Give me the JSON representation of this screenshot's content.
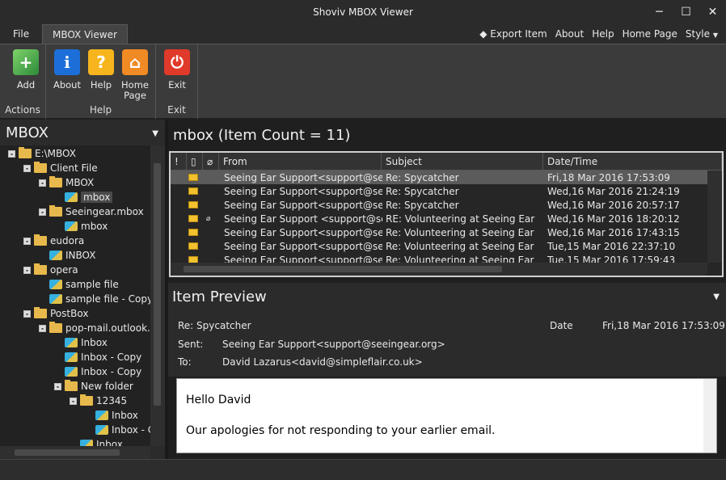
{
  "window": {
    "title": "Shoviv MBOX Viewer",
    "minimize": "─",
    "maximize": "☐",
    "close": "✕"
  },
  "menu": {
    "file": "File",
    "mbox_viewer": "MBOX Viewer",
    "export_item": "Export Item",
    "about": "About",
    "help": "Help",
    "home_page": "Home Page",
    "style": "Style"
  },
  "ribbon": {
    "add": "Add",
    "about": "About",
    "help": "Help",
    "home_page_1": "Home",
    "home_page_2": "Page",
    "exit": "Exit",
    "group_actions": "Actions",
    "group_help": "Help",
    "group_exit": "Exit"
  },
  "left": {
    "title": "MBOX",
    "tree": [
      {
        "label": "E:\\MBOX",
        "depth": 0,
        "type": "folder",
        "exp": "-"
      },
      {
        "label": "Client File",
        "depth": 1,
        "type": "folder",
        "exp": "-"
      },
      {
        "label": "MBOX",
        "depth": 2,
        "type": "folder",
        "exp": "-"
      },
      {
        "label": "mbox",
        "depth": 3,
        "type": "mbox",
        "exp": "",
        "selected": true
      },
      {
        "label": "Seeingear.mbox",
        "depth": 2,
        "type": "folder",
        "exp": "-"
      },
      {
        "label": "mbox",
        "depth": 3,
        "type": "mbox",
        "exp": ""
      },
      {
        "label": "eudora",
        "depth": 1,
        "type": "folder",
        "exp": "-"
      },
      {
        "label": "INBOX",
        "depth": 2,
        "type": "mbox",
        "exp": ""
      },
      {
        "label": "opera",
        "depth": 1,
        "type": "folder",
        "exp": "-"
      },
      {
        "label": "sample file",
        "depth": 2,
        "type": "mbox",
        "exp": ""
      },
      {
        "label": "sample file - Copy",
        "depth": 2,
        "type": "mbox",
        "exp": ""
      },
      {
        "label": "PostBox",
        "depth": 1,
        "type": "folder",
        "exp": "-"
      },
      {
        "label": "pop-mail.outlook.co",
        "depth": 2,
        "type": "folder",
        "exp": "-"
      },
      {
        "label": "Inbox",
        "depth": 3,
        "type": "mbox",
        "exp": ""
      },
      {
        "label": "Inbox - Copy",
        "depth": 3,
        "type": "mbox",
        "exp": ""
      },
      {
        "label": "Inbox - Copy",
        "depth": 3,
        "type": "mbox",
        "exp": ""
      },
      {
        "label": "New folder",
        "depth": 3,
        "type": "folder",
        "exp": "-"
      },
      {
        "label": "12345",
        "depth": 4,
        "type": "folder",
        "exp": "-"
      },
      {
        "label": "Inbox",
        "depth": 5,
        "type": "mbox",
        "exp": ""
      },
      {
        "label": "Inbox - C",
        "depth": 5,
        "type": "mbox",
        "exp": ""
      },
      {
        "label": "Inbox",
        "depth": 4,
        "type": "mbox",
        "exp": ""
      }
    ]
  },
  "list": {
    "title": "mbox (Item Count = 11)",
    "columns": {
      "from": "From",
      "subject": "Subject",
      "date": "Date/Time"
    },
    "rows": [
      {
        "from": "Seeing Ear Support<support@seeinge...",
        "subject": "Re: Spycatcher",
        "date": "Fri,18 Mar 2016 17:53:09",
        "attach": false
      },
      {
        "from": "Seeing Ear Support<support@seeinge...",
        "subject": "Re: Spycatcher",
        "date": "Wed,16 Mar 2016 21:24:19",
        "attach": false
      },
      {
        "from": "Seeing Ear Support<support@seeinge...",
        "subject": "Re: Spycatcher",
        "date": "Wed,16 Mar 2016 20:57:17",
        "attach": false
      },
      {
        "from": "Seeing Ear Support <support@seeinge...",
        "subject": "RE: Volunteering at Seeing Ear",
        "date": "Wed,16 Mar 2016 18:20:12",
        "attach": true
      },
      {
        "from": "Seeing Ear Support<support@seeinge...",
        "subject": "Re: Volunteering at Seeing Ear",
        "date": "Wed,16 Mar 2016 17:43:15",
        "attach": false
      },
      {
        "from": "Seeing Ear Support<support@seeinge...",
        "subject": "Re: Volunteering at Seeing Ear",
        "date": "Tue,15 Mar 2016 22:37:10",
        "attach": false
      },
      {
        "from": "Seeing Ear Support<support@seeinge...",
        "subject": "Re: Volunteering at Seeing Ear",
        "date": "Tue,15 Mar 2016 17:59:43",
        "attach": false
      }
    ]
  },
  "preview": {
    "title": "Item Preview",
    "subject": "Re: Spycatcher",
    "date_label": "Date",
    "date": "Fri,18 Mar 2016 17:53:09",
    "sent_label": "Sent:",
    "sent": "Seeing Ear Support<support@seeingear.org>",
    "to_label": "To:",
    "to": "David Lazarus<david@simpleflair.co.uk>",
    "body_line1": "Hello David",
    "body_line2": "Our apologies for not responding to your earlier email."
  }
}
